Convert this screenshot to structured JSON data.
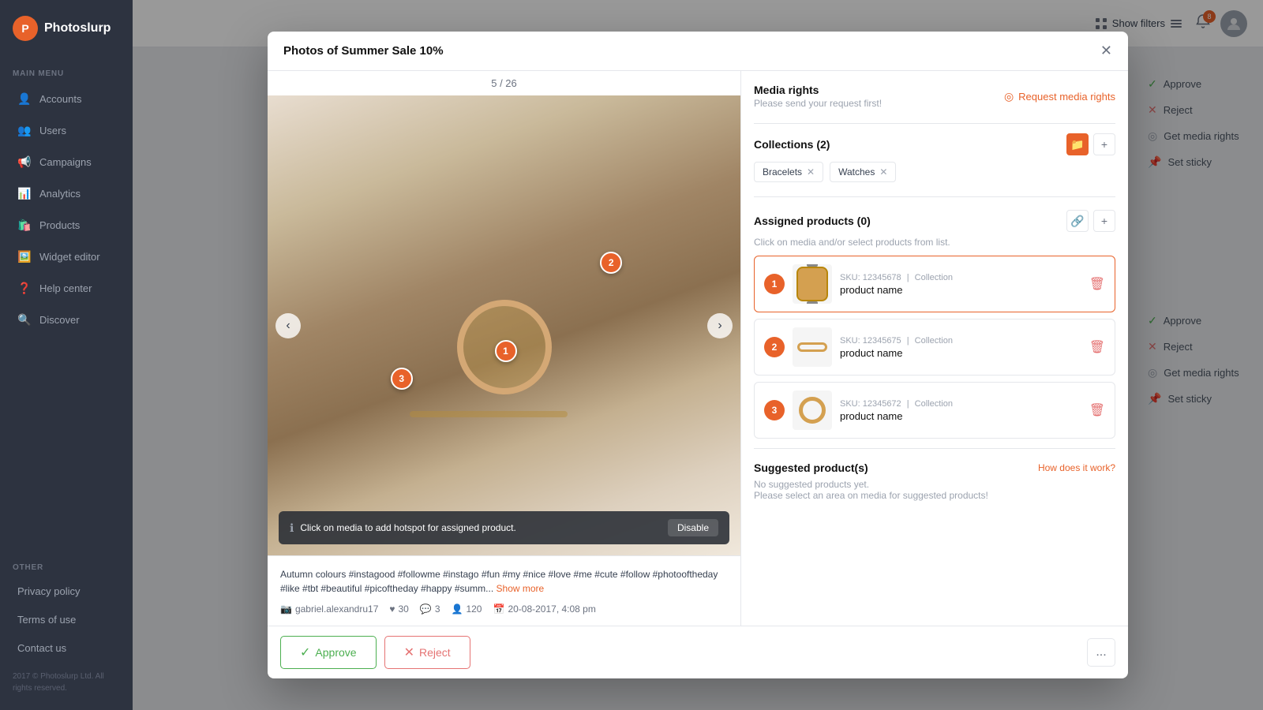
{
  "app": {
    "name": "Photoslurp",
    "logo_letter": "P"
  },
  "sidebar": {
    "main_menu_label": "MAIN MENU",
    "other_label": "OTHER",
    "items": [
      {
        "id": "accounts",
        "label": "Accounts",
        "icon": "👤"
      },
      {
        "id": "users",
        "label": "Users",
        "icon": "👥"
      },
      {
        "id": "campaigns",
        "label": "Campaigns",
        "icon": "📢"
      },
      {
        "id": "analytics",
        "label": "Analytics",
        "icon": "📊"
      },
      {
        "id": "products",
        "label": "Products",
        "icon": "🛍️"
      },
      {
        "id": "widget-editor",
        "label": "Widget editor",
        "icon": "🖼️"
      },
      {
        "id": "help-center",
        "label": "Help center",
        "icon": "❓"
      },
      {
        "id": "discover",
        "label": "Discover",
        "icon": "🔍"
      }
    ],
    "other_items": [
      {
        "id": "privacy-policy",
        "label": "Privacy policy"
      },
      {
        "id": "terms-of-use",
        "label": "Terms of use"
      },
      {
        "id": "contact-us",
        "label": "Contact us"
      }
    ],
    "footer_text": "2017 © Photoslurp Ltd.\nAll rights reserved."
  },
  "topbar": {
    "show_filters_label": "Show filters",
    "notification_count": "8"
  },
  "right_actions": {
    "items": [
      {
        "id": "approve-top",
        "label": "Approve",
        "icon": "✓"
      },
      {
        "id": "reject-top",
        "label": "Reject",
        "icon": "✕"
      },
      {
        "id": "get-media-top",
        "label": "Get media rights",
        "icon": "◎"
      },
      {
        "id": "set-sticky-top",
        "label": "Set sticky",
        "icon": "📌"
      },
      {
        "id": "approve-bot",
        "label": "Approve",
        "icon": "✓"
      },
      {
        "id": "reject-bot",
        "label": "Reject",
        "icon": "✕"
      },
      {
        "id": "get-media-bot",
        "label": "Get media rights",
        "icon": "◎"
      },
      {
        "id": "set-sticky-bot",
        "label": "Set sticky",
        "icon": "📌"
      }
    ]
  },
  "modal": {
    "title": "Photos of Summer Sale 10%",
    "counter": "5 / 26",
    "tooltip_text": "Click on media to add hotspot for assigned product.",
    "disable_label": "Disable",
    "caption": "Autumn colours #instagood #followme #instago #fun #my #nice #love #me #cute #follow #photooftheday #like #tbt #beautiful #picoftheday #happy #summ...",
    "show_more": "Show more",
    "username": "gabriel.alexandru17",
    "likes": "30",
    "comments": "3",
    "followers": "120",
    "date": "20-08-2017, 4:08 pm",
    "media_rights": {
      "title": "Media rights",
      "subtitle": "Please send your request first!",
      "request_btn": "Request media rights"
    },
    "collections": {
      "title": "Collections (2)",
      "items": [
        {
          "label": "Bracelets"
        },
        {
          "label": "Watches"
        }
      ]
    },
    "assigned_products": {
      "title": "Assigned products (0)",
      "instruction": "Click on media and/or select products from list.",
      "items": [
        {
          "num": "1",
          "sku": "SKU: 12345678",
          "collection": "Collection",
          "name": "product name",
          "active": true
        },
        {
          "num": "2",
          "sku": "SKU: 12345675",
          "collection": "Collection",
          "name": "product name",
          "active": false
        },
        {
          "num": "3",
          "sku": "SKU: 12345672",
          "collection": "Collection",
          "name": "product name",
          "active": false
        }
      ]
    },
    "suggested_products": {
      "title": "Suggested product(s)",
      "how_link": "How does it work?",
      "no_items": "No suggested products yet.",
      "no_items_sub": "Please select an area on media for suggested products!"
    },
    "footer": {
      "approve_label": "Approve",
      "reject_label": "Reject",
      "more_icon": "..."
    }
  }
}
